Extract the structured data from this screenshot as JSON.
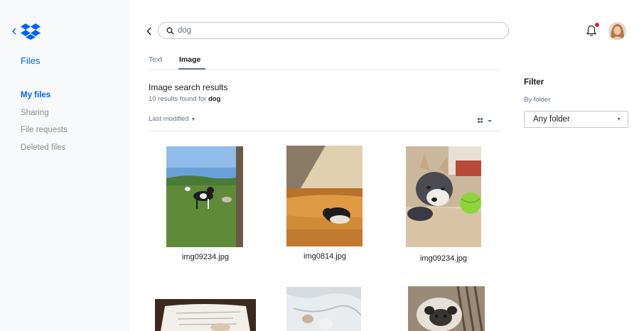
{
  "sidebar": {
    "title": "Files",
    "items": [
      {
        "label": "My files",
        "active": true
      },
      {
        "label": "Sharing"
      },
      {
        "label": "File requests"
      },
      {
        "label": "Deleted files"
      }
    ]
  },
  "search": {
    "value": "dog",
    "placeholder": ""
  },
  "tabs": [
    {
      "label": "Text",
      "active": false
    },
    {
      "label": "Image",
      "active": true
    }
  ],
  "results": {
    "title": "Image search results",
    "count_prefix": "10 results found for",
    "query": "dog"
  },
  "sort": {
    "label": "Last modified"
  },
  "files": [
    {
      "name": "img09234.jpg"
    },
    {
      "name": "img0814.jpg"
    },
    {
      "name": "img09234.jpg"
    }
  ],
  "filter": {
    "title": "Filter",
    "by_folder_label": "By folder",
    "folder_value": "Any folder"
  },
  "colors": {
    "accent": "#0061fe",
    "notification": "#e0242e"
  },
  "icons": [
    "dropbox-logo-icon",
    "chevron-left-icon",
    "search-icon",
    "bell-icon",
    "grid-view-icon",
    "caret-down-icon"
  ]
}
